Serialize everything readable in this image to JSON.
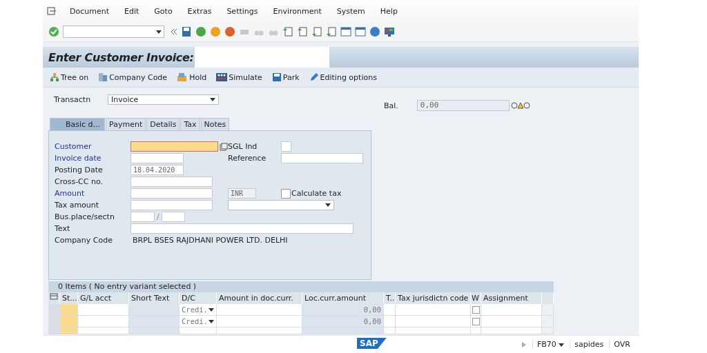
{
  "menu": [
    "Document",
    "Edit",
    "Goto",
    "Extras",
    "Settings",
    "Environment",
    "System",
    "Help"
  ],
  "title": "Enter Customer Invoice:",
  "app_toolbar": [
    {
      "kind": "tree",
      "label": "Tree on"
    },
    {
      "kind": "company",
      "label": "Company Code"
    },
    {
      "kind": "hold",
      "label": "Hold"
    },
    {
      "kind": "simulate",
      "label": "Simulate"
    },
    {
      "kind": "park",
      "label": "Park"
    },
    {
      "kind": "edit",
      "label": "Editing options"
    }
  ],
  "transaction": {
    "label": "Transactn",
    "value": "Invoice"
  },
  "balance": {
    "label": "Bal.",
    "value": "0,00"
  },
  "tabs": [
    {
      "label": "Basic d...",
      "selected": true
    },
    {
      "label": "Payment",
      "selected": false
    },
    {
      "label": "Details",
      "selected": false
    },
    {
      "label": "Tax",
      "selected": false
    },
    {
      "label": "Notes",
      "selected": false
    }
  ],
  "form": [
    {
      "kind": "focus",
      "label": "Customer",
      "required": true,
      "side": {
        "kind": "box",
        "label": "SGL Ind"
      }
    },
    {
      "kind": "short",
      "label": "Invoice date",
      "required": true,
      "side": {
        "kind": "field",
        "label": "Reference"
      }
    },
    {
      "kind": "short",
      "label": "Posting Date",
      "required": false,
      "value": "18.04.2020"
    },
    {
      "kind": "medium",
      "label": "Cross-CC no.",
      "required": false
    },
    {
      "kind": "medium",
      "label": "Amount",
      "required": true,
      "side": {
        "kind": "currency",
        "value": "INR",
        "check_label": "Calculate tax",
        "checked": false
      }
    },
    {
      "kind": "medium",
      "label": "Tax amount",
      "required": false,
      "side": {
        "kind": "select"
      }
    },
    {
      "kind": "split",
      "label": "Bus.place/sectn",
      "required": false,
      "separator": "/"
    },
    {
      "kind": "long",
      "label": "Text",
      "required": false
    },
    {
      "kind": "text",
      "label": "Company Code",
      "required": false,
      "value": "BRPL BSES RAJDHANI POWER LTD. DELHI"
    }
  ],
  "table": {
    "title": "0 Items ( No entry variant selected )",
    "columns": [
      "St...",
      "G/L acct",
      "Short Text",
      "D/C",
      "Amount in doc.curr.",
      "Loc.curr.amount",
      "T..",
      "Tax jurisdictn code",
      "W",
      "Assignment"
    ],
    "rows": [
      {
        "dc": "Credi.",
        "loc_amount": "0,00",
        "checked": false
      },
      {
        "dc": "Credi.",
        "loc_amount": "0,00",
        "checked": false
      }
    ]
  },
  "status_bar": {
    "logo": "SAP",
    "transaction": "FB70",
    "server": "sapides",
    "mode": "OVR"
  }
}
